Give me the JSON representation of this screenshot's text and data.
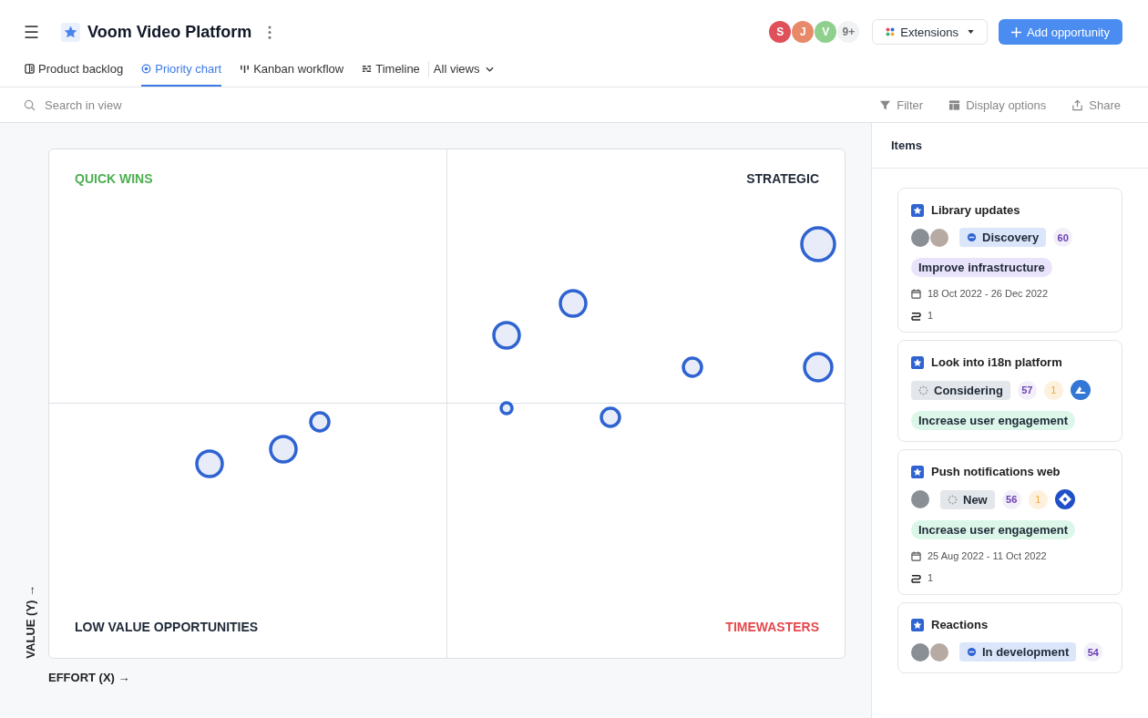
{
  "header": {
    "menu_icon": "☰",
    "title": "Voom Video Platform",
    "avatars": [
      {
        "initial": "S",
        "color": "#e0505a"
      },
      {
        "initial": "J",
        "color": "#e8896a"
      },
      {
        "initial": "V",
        "color": "#8fd08f"
      }
    ],
    "more_count": "9+",
    "extensions": "Extensions",
    "add_button": "Add opportunity"
  },
  "tabs": [
    {
      "label": "Product backlog",
      "kind": "list",
      "selected": false
    },
    {
      "label": "Priority chart",
      "kind": "target",
      "selected": true
    },
    {
      "label": "Kanban workflow",
      "kind": "kanban",
      "selected": false
    },
    {
      "label": "Timeline",
      "kind": "timeline",
      "selected": false
    }
  ],
  "all_views": "All views",
  "toolbar": {
    "search": {
      "placeholder": "Search in view"
    },
    "actions": [
      {
        "label": "Filter",
        "kind": "filter"
      },
      {
        "label": "Display options",
        "kind": "layout"
      },
      {
        "label": "Share",
        "kind": "share"
      }
    ]
  },
  "chart": {
    "quadrants": [
      {
        "label": "QUICK WINS",
        "color": "#4caf50"
      },
      {
        "label": "STRATEGIC",
        "color": "#1f2937"
      },
      {
        "label": "LOW VALUE OPPORTUNITIES",
        "color": "#1f2937"
      },
      {
        "label": "TIMEWASTERS",
        "color": "#e5484d"
      }
    ],
    "y_axis_label": "VALUE (Y) →",
    "x_axis_label": "EFFORT (X) →"
  },
  "panel": {
    "title": "Items",
    "cards": [
      {
        "title": "Library updates",
        "avatars": [
          {
            "kind": "photo"
          },
          {
            "kind": "photo"
          }
        ],
        "status": {
          "label": "Discovery",
          "kind": "discovery"
        },
        "score": "60",
        "goal": {
          "label": "Improve infrastructure",
          "color": "#e9e3fb"
        },
        "dates": "18 Oct 2022 - 26 Dec 2022",
        "links": "1"
      },
      {
        "title": "Look into i18n platform",
        "status": {
          "label": "Considering",
          "kind": "considering"
        },
        "score": "57",
        "comments": "1",
        "integration": {
          "kind": "mountain"
        },
        "goal": {
          "label": "Increase user engagement",
          "color": "#dcf7ea"
        }
      },
      {
        "title": "Push notifications web",
        "avatars": [
          {
            "kind": "photo"
          }
        ],
        "status": {
          "label": "New",
          "kind": "considering"
        },
        "score": "56",
        "comments": "1",
        "integration": {
          "kind": "diamond"
        },
        "goal": {
          "label": "Increase user engagement",
          "color": "#dcf7ea"
        },
        "dates": "25 Aug 2022 - 11 Oct 2022",
        "links": "1"
      },
      {
        "title": "Reactions",
        "avatars": [
          {
            "kind": "photo"
          },
          {
            "kind": "photo"
          }
        ],
        "status": {
          "label": "In development",
          "kind": "discovery"
        },
        "score": "54"
      }
    ]
  }
}
